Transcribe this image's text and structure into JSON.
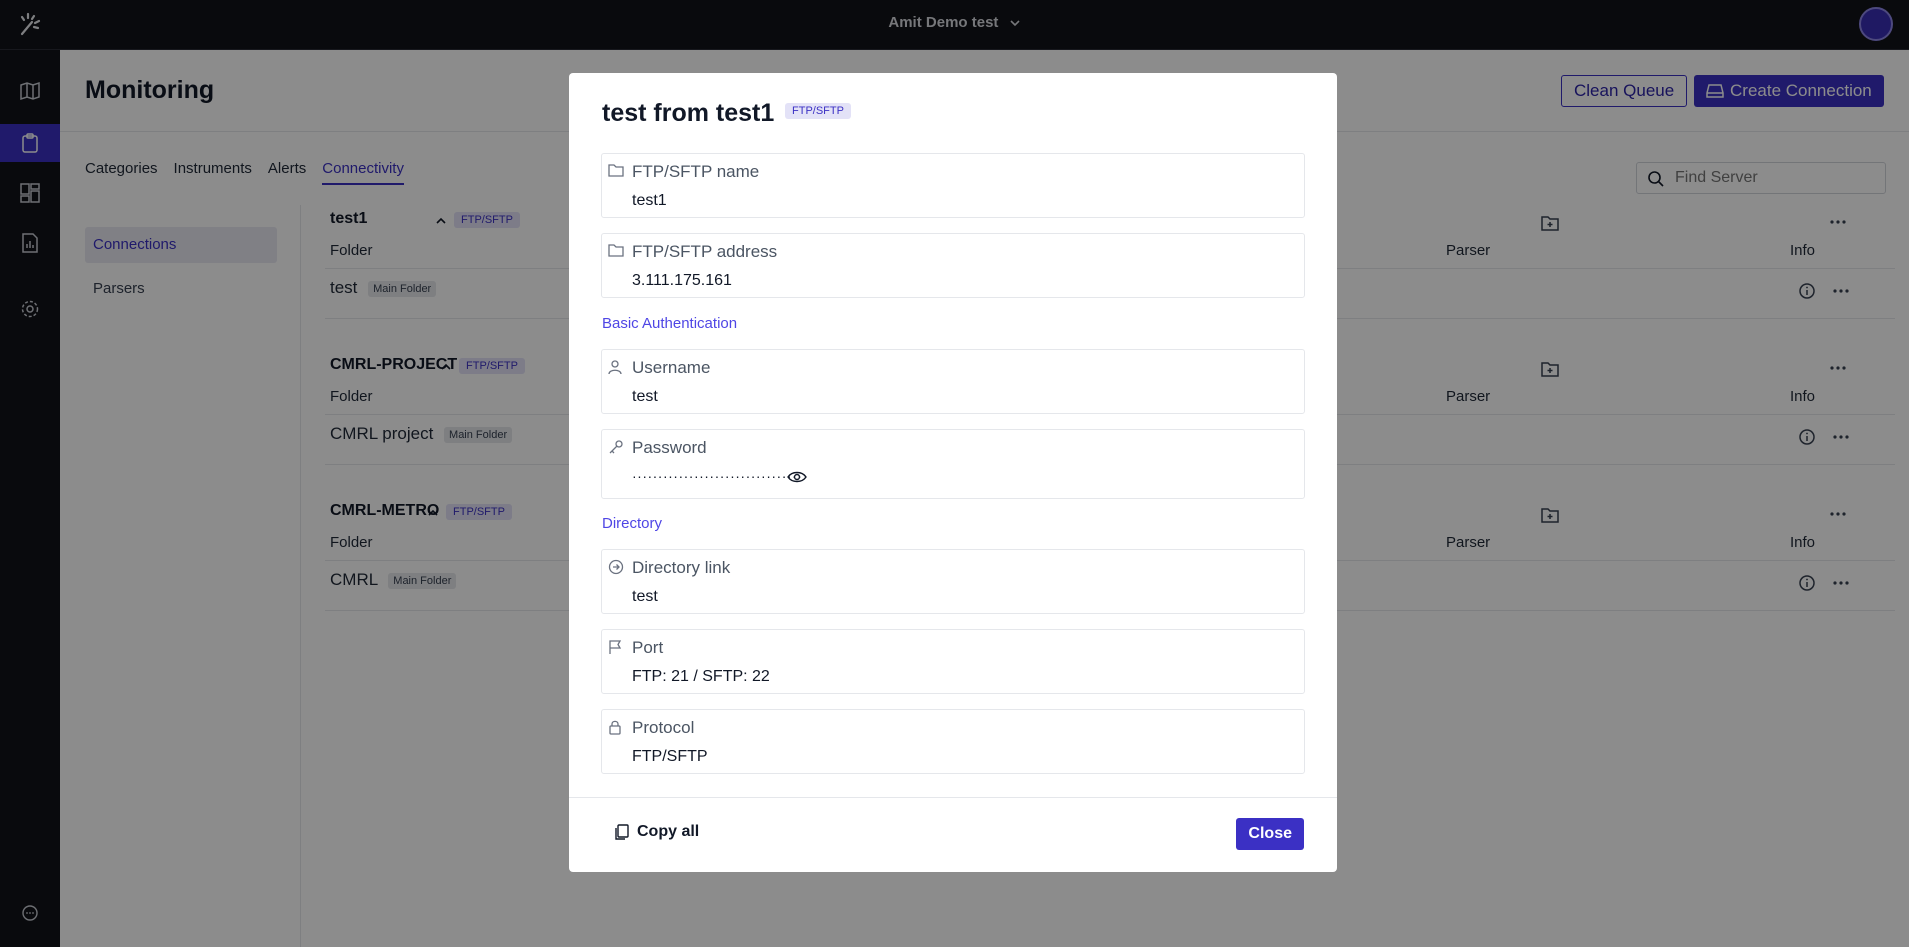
{
  "topbar": {
    "workspace": "Amit Demo test"
  },
  "page": {
    "title": "Monitoring",
    "clean_queue": "Clean Queue",
    "create_connection": "Create Connection",
    "search_placeholder": "Find Server"
  },
  "tabs": [
    "Categories",
    "Instruments",
    "Alerts",
    "Connectivity"
  ],
  "subnav": [
    "Connections",
    "Parsers"
  ],
  "columns": {
    "folder": "Folder",
    "parser": "Parser",
    "info": "Info"
  },
  "groups": [
    {
      "name": "test1",
      "tag": "FTP/SFTP",
      "row": "test",
      "row_tag": "Main Folder"
    },
    {
      "name": "CMRL-PROJECT",
      "tag": "FTP/SFTP",
      "row": "CMRL project",
      "row_tag": "Main Folder"
    },
    {
      "name": "CMRL-METRO",
      "tag": "FTP/SFTP",
      "row": "CMRL",
      "row_tag": "Main Folder"
    }
  ],
  "modal": {
    "title": "test from test1",
    "tag": "FTP/SFTP",
    "fields": {
      "name": {
        "label": "FTP/SFTP name",
        "value": "test1"
      },
      "address": {
        "label": "FTP/SFTP address",
        "value": "3.111.175.161"
      },
      "username": {
        "label": "Username",
        "value": "test"
      },
      "password": {
        "label": "Password",
        "value": "·································"
      },
      "directory": {
        "label": "Directory link",
        "value": "test"
      },
      "port": {
        "label": "Port",
        "value": "FTP: 21 / SFTP: 22"
      },
      "protocol": {
        "label": "Protocol",
        "value": "FTP/SFTP"
      }
    },
    "sections": {
      "auth": "Basic Authentication",
      "directory": "Directory"
    },
    "copy_all": "Copy all",
    "close": "Close"
  },
  "colors": {
    "accent": "#3b30c4",
    "topbar": "#111318"
  }
}
